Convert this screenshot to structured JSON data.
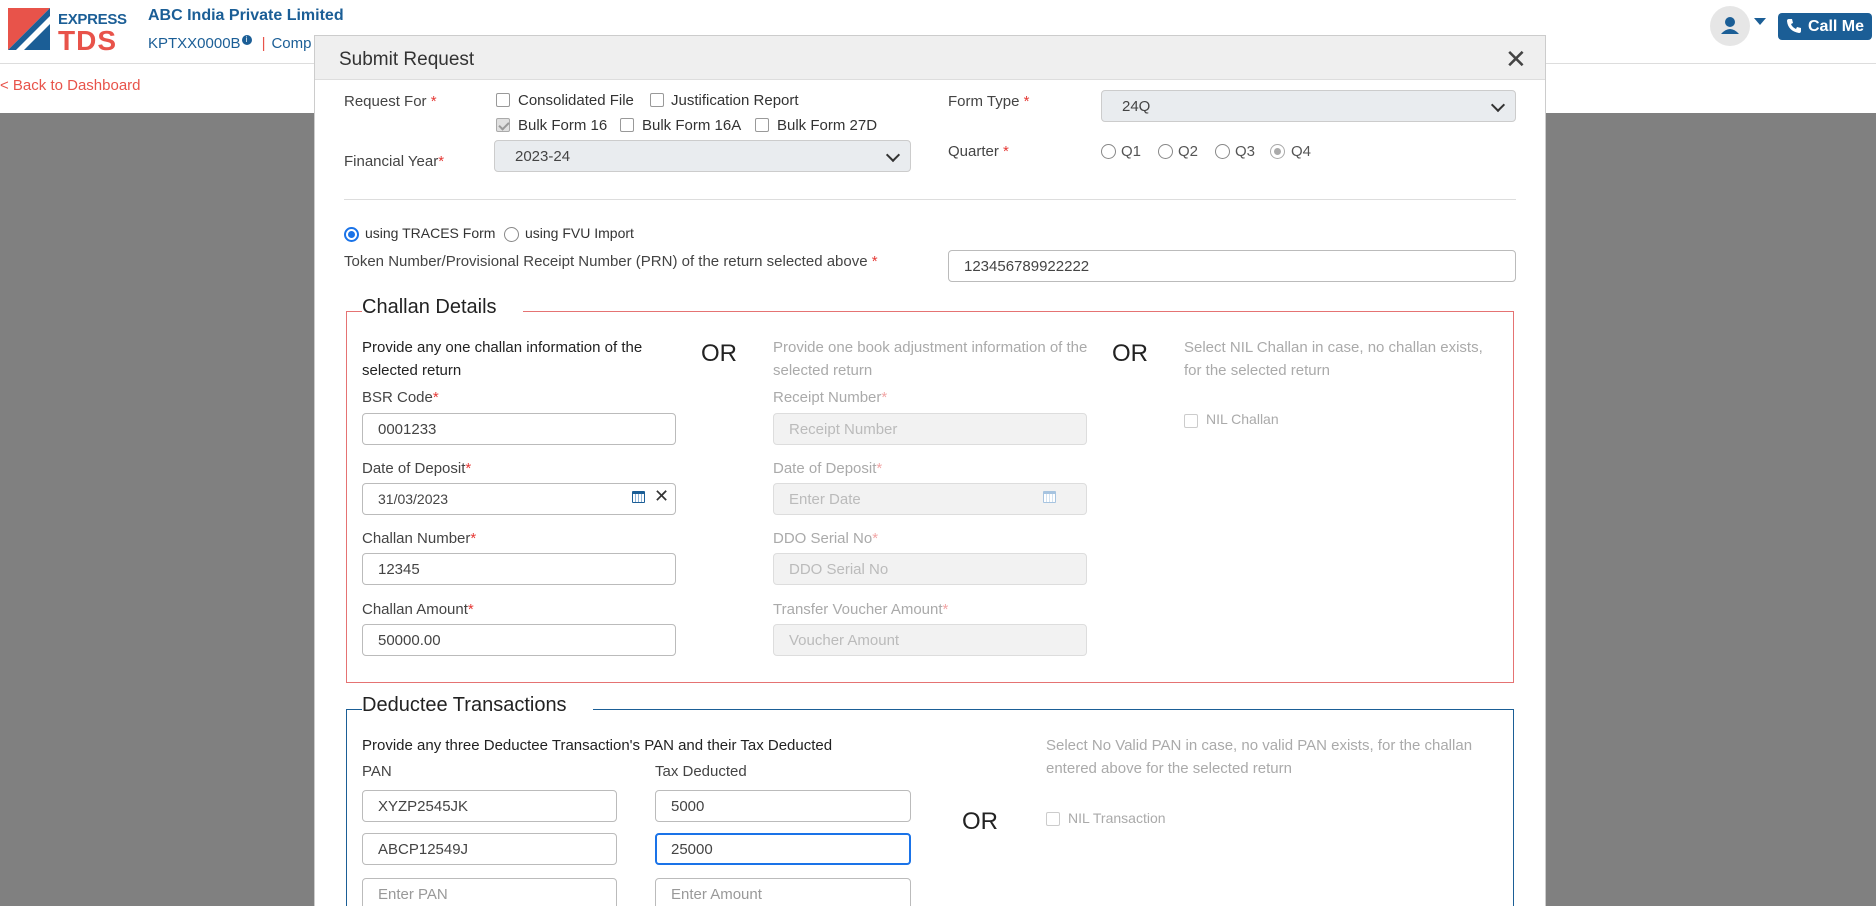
{
  "header": {
    "logo_top": "EXPRESS",
    "logo_bottom": "TDS",
    "company_name": "ABC India Private Limited",
    "tan": "KPTXX0000B",
    "tan_info_icon": "info-icon",
    "company_link_partial": "Comp",
    "call_me_label": "Call Me",
    "user_icon": "user-icon",
    "phone_icon": "phone-icon"
  },
  "back_link": "< Back to Dashboard",
  "modal": {
    "title": "Submit Request",
    "close": "✕",
    "request_for": {
      "label": "Request For ",
      "options": [
        {
          "label": "Consolidated File",
          "checked": false
        },
        {
          "label": "Justification Report",
          "checked": false
        },
        {
          "label": "Bulk Form 16",
          "checked": true
        },
        {
          "label": "Bulk Form 16A",
          "checked": false
        },
        {
          "label": "Bulk Form 27D",
          "checked": false
        }
      ]
    },
    "financial_year": {
      "label": "Financial Year",
      "value": "2023-24"
    },
    "form_type": {
      "label": "Form Type ",
      "value": "24Q"
    },
    "quarter": {
      "label": "Quarter ",
      "options": [
        "Q1",
        "Q2",
        "Q3",
        "Q4"
      ],
      "selected": "Q4"
    },
    "method": {
      "options": [
        "using TRACES Form",
        "using FVU Import"
      ],
      "selected": "using TRACES Form"
    },
    "token": {
      "label": "Token Number/Provisional Receipt Number (PRN) of the return selected above ",
      "value": "123456789922222"
    },
    "required_mark": "*",
    "challan": {
      "legend": "Challan Details",
      "or": "OR",
      "col1_intro": "Provide any one challan information of the selected return",
      "bsr_label": "BSR Code",
      "bsr_value": "0001233",
      "date_label": "Date of Deposit",
      "date_value": "31/03/2023",
      "challan_no_label": "Challan Number",
      "challan_no_value": "12345",
      "amount_label": "Challan Amount",
      "amount_value": "50000.00",
      "col2_intro": "Provide one book adjustment information of the selected return",
      "receipt_label": "Receipt Number",
      "receipt_placeholder": "Receipt Number",
      "date2_label": "Date of Deposit",
      "date2_placeholder": "Enter Date",
      "ddo_label": "DDO Serial No",
      "ddo_placeholder": "DDO Serial No",
      "voucher_label": "Transfer Voucher Amount",
      "voucher_placeholder": "Voucher Amount",
      "col3_intro": "Select NIL Challan in case, no challan exists, for the selected return",
      "nil_label": "NIL Challan"
    },
    "deductee": {
      "legend": "Deductee Transactions",
      "intro": "Provide any three Deductee Transaction's PAN and their Tax Deducted",
      "pan_header": "PAN",
      "tax_header": "Tax Deducted",
      "rows": [
        {
          "pan": "XYZP2545JK",
          "tax": "5000"
        },
        {
          "pan": "ABCP12549J",
          "tax": "25000"
        }
      ],
      "pan_placeholder": "Enter PAN",
      "tax_placeholder": "Enter Amount",
      "or": "OR",
      "right_intro": "Select No Valid PAN in case, no valid PAN exists, for the challan entered above for the selected return",
      "nil_label": "NIL Transaction"
    }
  }
}
